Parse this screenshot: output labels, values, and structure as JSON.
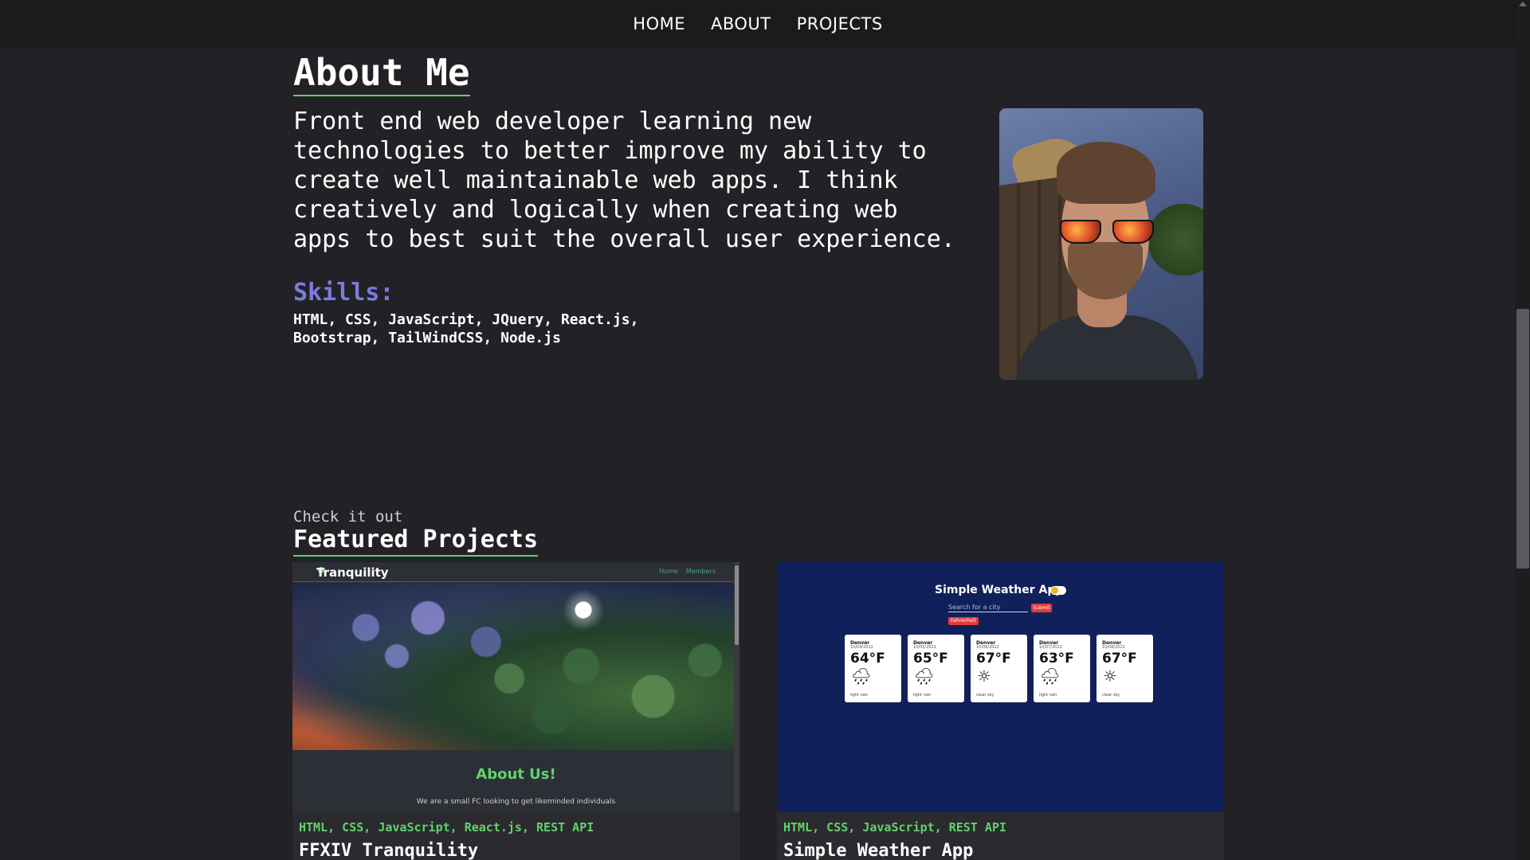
{
  "nav": {
    "links": [
      "HOME",
      "ABOUT",
      "PROJECTS"
    ]
  },
  "about": {
    "title": "About Me",
    "bio": "Front end web developer learning new technologies to better improve my ability to create well maintainable web apps. I think creatively and logically when creating web apps to best suit the overall user experience.",
    "skills_title": "Skills:",
    "skills": "HTML, CSS, JavaScript, JQuery, React.js, Bootstrap, TailWindCSS, Node.js"
  },
  "projects": {
    "kicker": "Check it out",
    "title": "Featured Projects",
    "items": [
      {
        "title": "FFXIV Tranquility",
        "tags": "HTML, CSS, JavaScript, React.js, REST API",
        "preview": {
          "logo": "Tranquility",
          "links": [
            "Home",
            "Members"
          ],
          "section_title": "About Us!",
          "section_text": "We are a small FC looking to get likeminded individuals"
        }
      },
      {
        "title": "Simple Weather App",
        "tags": "HTML, CSS, JavaScript, REST API",
        "preview": {
          "app_title": "Simple Weather App",
          "search_placeholder": "Search for a city",
          "submit_label": "Submit",
          "unit_label": "Fahrenheit",
          "forecast": [
            {
              "city": "Denver",
              "date": "10/04/2022",
              "temp": "64°F",
              "icon": "rain-cloud-icon",
              "desc": "light rain"
            },
            {
              "city": "Denver",
              "date": "10/05/2022",
              "temp": "65°F",
              "icon": "rain-cloud-icon",
              "desc": "light rain"
            },
            {
              "city": "Denver",
              "date": "10/06/2022",
              "temp": "67°F",
              "icon": "sun-icon",
              "desc": "clear sky"
            },
            {
              "city": "Denver",
              "date": "10/07/2022",
              "temp": "63°F",
              "icon": "rain-cloud-icon",
              "desc": "light rain"
            },
            {
              "city": "Denver",
              "date": "10/08/2022",
              "temp": "67°F",
              "icon": "sun-icon",
              "desc": "clear sky"
            }
          ]
        }
      }
    ]
  },
  "colors": {
    "background": "#222125",
    "accent_green": "#61d26b",
    "skills_purple": "#7b7ce0",
    "weather_bg": "#10205a"
  }
}
